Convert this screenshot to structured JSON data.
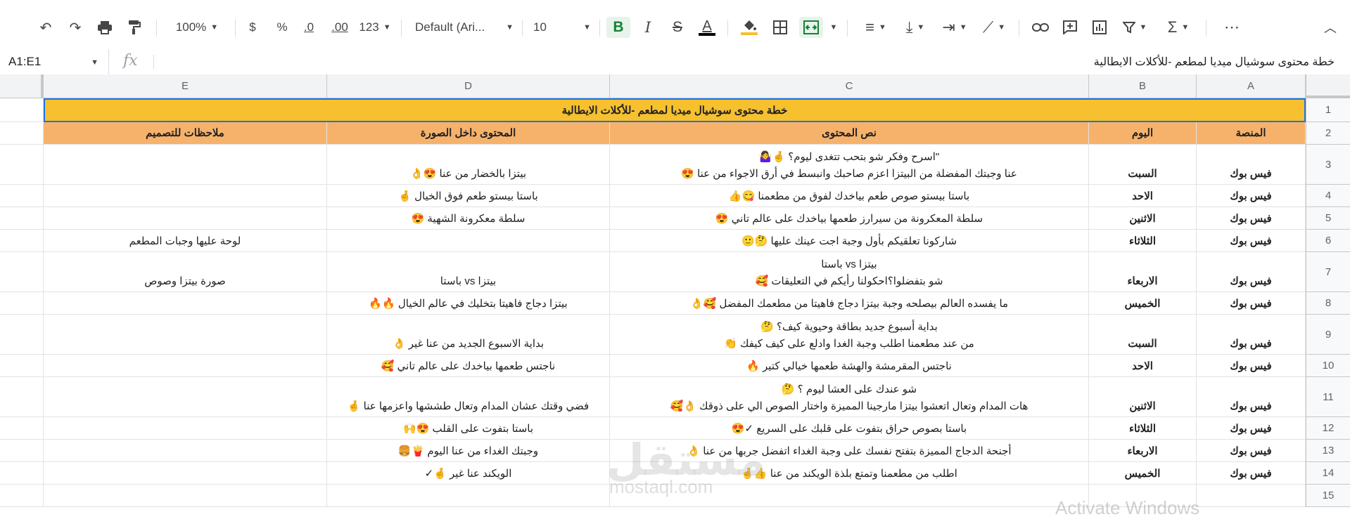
{
  "toolbar": {
    "zoom": "100%",
    "currency": "$",
    "percent": "%",
    "dec_decrease": ".0",
    "dec_increase": ".00",
    "format_more": "123",
    "font": "Default (Ari...",
    "font_size": "10",
    "bold": "B",
    "italic": "I",
    "strike": "S",
    "text_color": "A",
    "more": "⋯",
    "icons": [
      "undo-icon",
      "redo-icon",
      "print-icon",
      "paint-format-icon",
      "fill-color-icon",
      "borders-icon",
      "merge-icon",
      "align-icon",
      "valign-icon",
      "wrap-icon",
      "rotate-icon",
      "link-icon",
      "comment-icon",
      "chart-icon",
      "filter-icon",
      "functions-icon"
    ],
    "active_color": "#188038"
  },
  "formula_bar": {
    "name_box": "A1:E1",
    "fx": "fx",
    "content": "خطة محتوى سوشيال ميديا لمطعم -للأكلات الايطالية"
  },
  "columns": [
    "E",
    "D",
    "C",
    "B",
    "A"
  ],
  "rows": [
    "1",
    "2",
    "3",
    "4",
    "5",
    "6",
    "7",
    "8",
    "9",
    "10",
    "11",
    "12",
    "13",
    "14",
    "15"
  ],
  "sheet": {
    "title": "خطة محتوى سوشيال ميديا لمطعم -للأكلات الايطالية",
    "title_color": "#f6c02e",
    "header_color": "#f6b26b",
    "headers": {
      "A": "المنصة",
      "B": "اليوم",
      "C": "نص المحتوى",
      "D": "المحتوى داخل الصورة",
      "E": "ملاحظات للتصميم"
    },
    "data": [
      {
        "A": "فيس بوك",
        "B": "السبت",
        "C1": "\"اسرح وفكر شو بتحب تتغدى ليوم؟ 🤞🤷‍♀️",
        "C2": "عنا وجبتك المفضلة من البيتزا اعزم صاحبك وانبسط في أرق الاجواء من عنا 😍",
        "D": "بيتزا بالخضار من عنا 😍👌",
        "E": ""
      },
      {
        "A": "فيس بوك",
        "B": "الاحد",
        "C1": "",
        "C2": "باستا بيستو صوص طعم بياخدك لفوق من مطعمنا 😋👍",
        "D": "باستا بيستو طعم فوق الخيال 🤞",
        "E": ""
      },
      {
        "A": "فيس بوك",
        "B": "الاثنين",
        "C1": "",
        "C2": "سلطة المعكرونة من سيرارز طعمها بياخدك على عالم تاني 😍",
        "D": "سلطة معكرونة  الشهية 😍",
        "E": ""
      },
      {
        "A": "فيس بوك",
        "B": "الثلاثاء",
        "C1": "",
        "C2": "شاركونا تعلقيكم بأول وجبة اجت عينك عليها 🤔🙂",
        "D": "",
        "E": "لوحة عليها وجبات المطعم"
      },
      {
        "A": "فيس بوك",
        "B": "الاربعاء",
        "C1": "بيتزا  vs  باستا",
        "C2": "شو بتفضلوا؟احكولنا رأيكم في التعليقات 🥰",
        "D": "بيتزا vs باستا",
        "E": "صورة بيتزا وصوص"
      },
      {
        "A": "فيس بوك",
        "B": "الخميس",
        "C1": "",
        "C2": "ما يفسده العالم بيصلحه وجبة بيتزا دجاج فاهيتا من مطعمك المفضل 🥰👌",
        "D": "بيتزا دجاج فاهيتا بتخليك في عالم الخيال 🔥🔥",
        "E": ""
      },
      {
        "A": "فيس بوك",
        "B": "السبت",
        "C1": "بداية أسبوع جديد بطاقة وحيوية كيف؟ 🤔",
        "C2": "من عند مطعمنا  اطلب وجبة الغدا وادلع على كيف كيفك 👏",
        "D": "بداية الاسبوع الجديد من عنا غير 👌",
        "E": ""
      },
      {
        "A": "فيس بوك",
        "B": "الاحد",
        "C1": "",
        "C2": "ناجتس  المقرمشة والهشة طعمها خيالي كتير 🔥",
        "D": "ناجتس طعمها بياخدك على عالم تاني 🥰",
        "E": ""
      },
      {
        "A": "فيس بوك",
        "B": "الاثنين",
        "C1": "شو عندك على العشا ليوم ؟ 🤔",
        "C2": "هات المدام وتعال اتعشوا بيتزا مارجينا المميزة واختار الصوص الي على ذوقك 👌🥰",
        "D": "فضي وقتك عشان المدام وتعال طششها واعزمها عنا 🤞",
        "E": ""
      },
      {
        "A": "فيس بوك",
        "B": "الثلاثاء",
        "C1": "",
        "C2": "باستا بصوص حراق بتفوت على قلبك على السريع ✓😍",
        "D": "باستا بتفوت على القلب 😍🙌",
        "E": ""
      },
      {
        "A": "فيس بوك",
        "B": "الاربعاء",
        "C1": "",
        "C2": "أجنحة الدجاج المميزة بتفتح نفسك على وجبة الغداء اتفضل جربها من عنا 👌",
        "D": "وجبتك الغداء من عنا اليوم 🍟🍔",
        "E": ""
      },
      {
        "A": "فيس بوك",
        "B": "الخميس",
        "C1": "",
        "C2": "اطلب من مطعمنا  وتمتع بلذة الويكند من عنا 👍🤞",
        "D": "الويكند عنا غير 🤞✓",
        "E": ""
      }
    ]
  },
  "watermark": {
    "logo": "مستقل",
    "site": "mostaql.com"
  },
  "overlay": "Activate Windows"
}
